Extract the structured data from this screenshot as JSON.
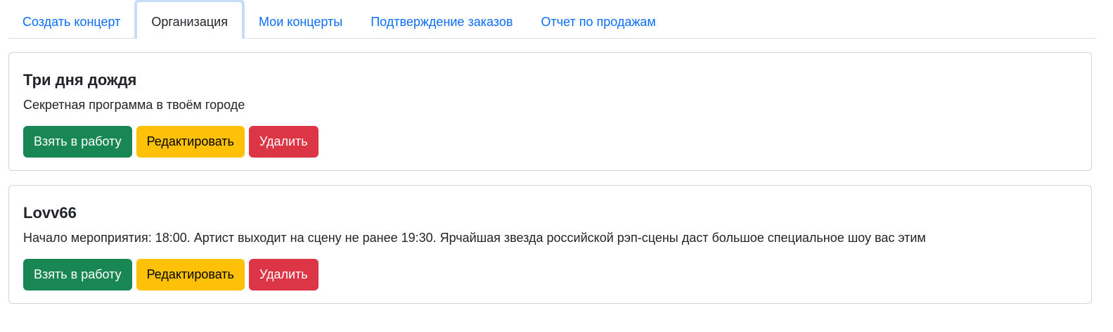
{
  "tabs": [
    {
      "label": "Создать концерт",
      "active": false
    },
    {
      "label": "Организация",
      "active": true
    },
    {
      "label": "Мои концерты",
      "active": false
    },
    {
      "label": "Подтверждение заказов",
      "active": false
    },
    {
      "label": "Отчет по продажам",
      "active": false
    }
  ],
  "actions": {
    "take": "Взять в работу",
    "edit": "Редактировать",
    "delete": "Удалить"
  },
  "concerts": [
    {
      "title": "Три дня дождя",
      "description": "Секретная программа в твоём городе"
    },
    {
      "title": "Lovv66",
      "description": "Начало мероприятия: 18:00. Артист выходит на сцену не ранее 19:30. Ярчайшая звезда российской рэп-сцены даст большое специальное шоу вас этим"
    }
  ],
  "colors": {
    "link": "#0d6efd",
    "success": "#198754",
    "warning": "#ffc107",
    "danger": "#dc3545",
    "active_tab_outline": "#c5dcfb"
  }
}
